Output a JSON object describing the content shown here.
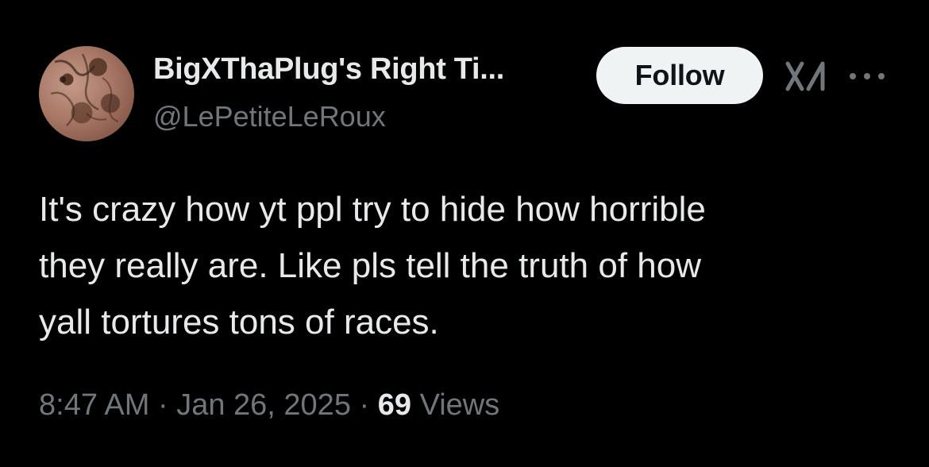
{
  "author": {
    "display_name": "BigXThaPlug's Right Ti...",
    "handle": "@LePetiteLeRoux",
    "avatar_icon": "profile-photo"
  },
  "actions": {
    "follow_label": "Follow",
    "grok_icon": "grok-icon",
    "more_icon": "more-dots-icon"
  },
  "tweet": {
    "lines": [
      "It's crazy how yt ppl try to hide how horrible",
      "they really are. Like pls tell the truth of how",
      "yall tortures tons of races."
    ]
  },
  "meta": {
    "time": "8:47 AM",
    "separator": " · ",
    "date": "Jan 26, 2025",
    "views_count": "69",
    "views_label": " Views"
  },
  "colors": {
    "background": "#000000",
    "primary_text": "#e7e9ea",
    "secondary_text": "#71767b",
    "follow_button_bg": "#eff3f4",
    "follow_button_text": "#0f1419"
  }
}
